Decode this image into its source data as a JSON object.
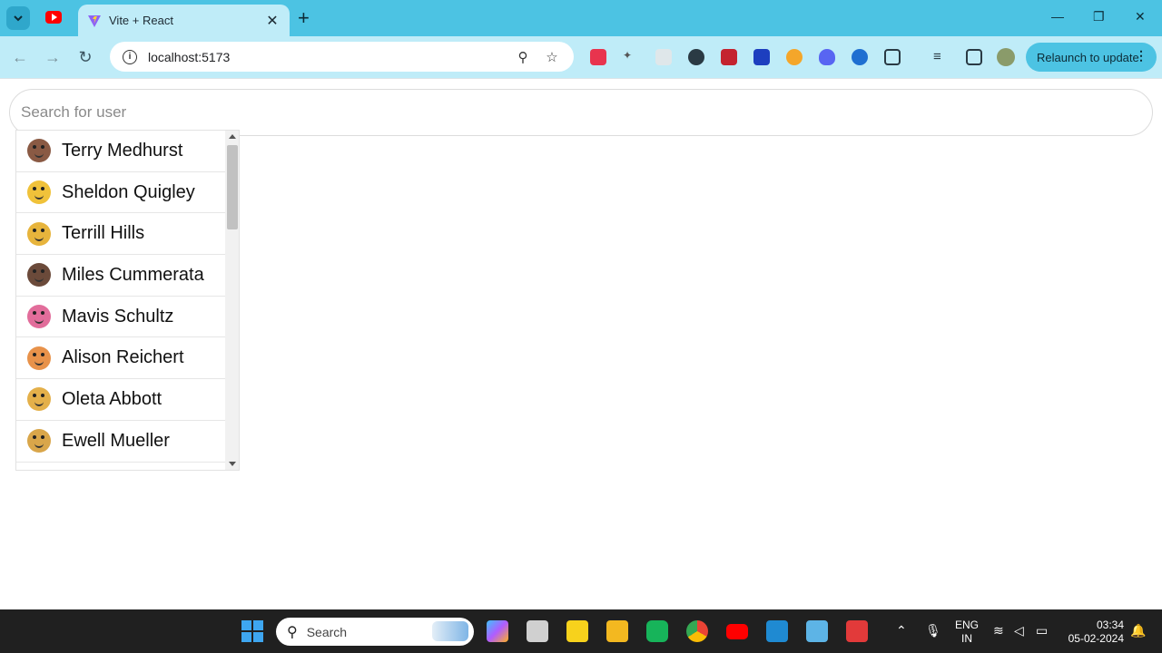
{
  "browser": {
    "tab_title": "Vite + React",
    "url": "localhost:5173",
    "relaunch_label": "Relaunch to update",
    "colors": {
      "tabbar": "#4cc3e3",
      "toolbar": "#bfecf8"
    }
  },
  "page": {
    "search_placeholder": "Search for user",
    "users": [
      {
        "name": "Terry Medhurst",
        "avatar_color": "#8a5a44"
      },
      {
        "name": "Sheldon Quigley",
        "avatar_color": "#f0c23a"
      },
      {
        "name": "Terrill Hills",
        "avatar_color": "#e7b43c"
      },
      {
        "name": "Miles Cummerata",
        "avatar_color": "#6b4a3a"
      },
      {
        "name": "Mavis Schultz",
        "avatar_color": "#e26d9b"
      },
      {
        "name": "Alison Reichert",
        "avatar_color": "#e8924a"
      },
      {
        "name": "Oleta Abbott",
        "avatar_color": "#e4b04a"
      },
      {
        "name": "Ewell Mueller",
        "avatar_color": "#d9a64a"
      }
    ]
  },
  "taskbar": {
    "search_label": "Search",
    "lang_top": "ENG",
    "lang_bottom": "IN",
    "time": "03:34",
    "date": "05-02-2024"
  }
}
